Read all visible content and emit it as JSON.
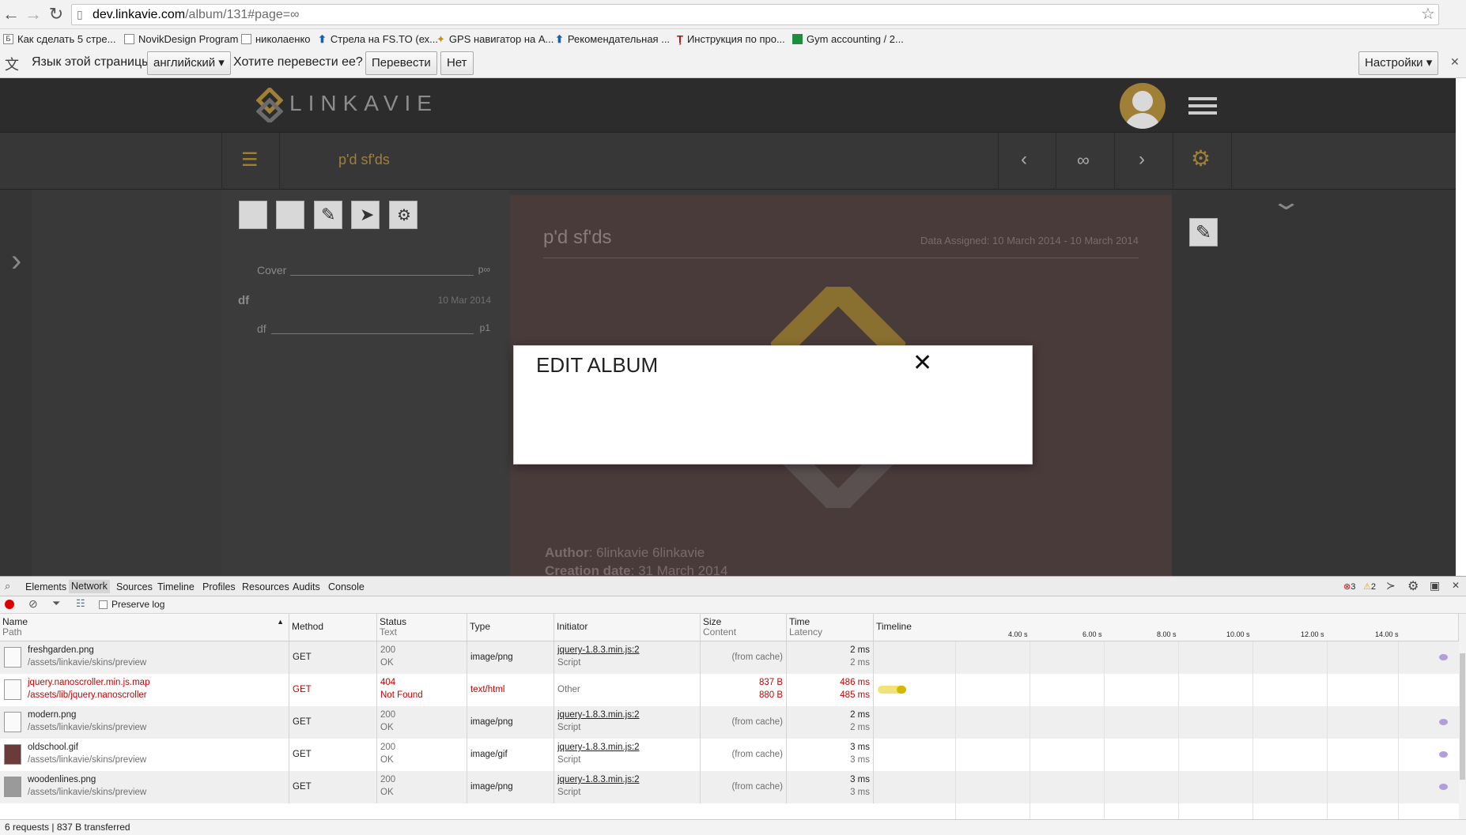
{
  "browser": {
    "url_host": "dev.linkavie.com",
    "url_path": "/album/131#page=∞",
    "bookmarks": [
      {
        "label": "Как сделать 5 стре..."
      },
      {
        "label": "NovikDesign Program"
      },
      {
        "label": "николаенко"
      },
      {
        "label": "Стрела на FS.TO (ех..."
      },
      {
        "label": "GPS навигатор на А..."
      },
      {
        "label": "Рекомендательная ..."
      },
      {
        "label": "Инструкция по про..."
      },
      {
        "label": "Gym accounting / 2..."
      }
    ],
    "translate": {
      "prompt": "Язык этой страницы",
      "language": "английский",
      "question": "Хотите перевести ее?",
      "translate_button": "Перевести",
      "no_button": "Нет",
      "settings_button": "Настройки"
    }
  },
  "app": {
    "brand": "LINKAVIE",
    "album_name": "p'd sf'ds",
    "infinity": "∞",
    "toc": [
      {
        "label": "Cover",
        "page": "p∞"
      },
      {
        "section": "df",
        "date": "10 Mar 2014"
      },
      {
        "label": "df",
        "page": "p1"
      }
    ],
    "page": {
      "title": "p'd sf'ds",
      "date_assigned": "Data Assigned: 10 March 2014 - 10 March 2014",
      "author_label": "Author",
      "author_value": ": 6linkavie 6linkavie",
      "creation_label": "Creation date",
      "creation_value": ": 31 March 2014"
    },
    "colors": {
      "accent": "#a08037",
      "header": "#2c2c2c",
      "page": "#4a3b3b"
    }
  },
  "modal": {
    "title": "EDIT ALBUM",
    "close_icon": "✕"
  },
  "devtools": {
    "tabs": [
      "Elements",
      "Network",
      "Sources",
      "Timeline",
      "Profiles",
      "Resources",
      "Audits",
      "Console"
    ],
    "errors": "3",
    "warnings": "2",
    "preserve_log": "Preserve log",
    "headers": {
      "name": "Name",
      "path": "Path",
      "method": "Method",
      "status": "Status",
      "text": "Text",
      "type": "Type",
      "initiator": "Initiator",
      "size": "Size",
      "content": "Content",
      "time": "Time",
      "latency": "Latency",
      "timeline": "Timeline"
    },
    "timeline_ticks": [
      "4.00 s",
      "6.00 s",
      "8.00 s",
      "10.00 s",
      "12.00 s",
      "14.00 s"
    ],
    "rows": [
      {
        "name": "freshgarden.png",
        "path": "/assets/linkavie/skins/preview",
        "method": "GET",
        "status": "200",
        "status_text": "OK",
        "type": "image/png",
        "initiator": "jquery-1.8.3.min.js:2",
        "initiator_sub": "Script",
        "size": "(from cache)",
        "size_sub": "",
        "time": "2 ms",
        "latency": "2 ms",
        "error": false
      },
      {
        "name": "jquery.nanoscroller.min.js.map",
        "path": "/assets/lib/jquery.nanoscroller",
        "method": "GET",
        "status": "404",
        "status_text": "Not Found",
        "type": "text/html",
        "initiator": "Other",
        "initiator_sub": "",
        "size": "837 B",
        "size_sub": "880 B",
        "time": "486 ms",
        "latency": "485 ms",
        "error": true
      },
      {
        "name": "modern.png",
        "path": "/assets/linkavie/skins/preview",
        "method": "GET",
        "status": "200",
        "status_text": "OK",
        "type": "image/png",
        "initiator": "jquery-1.8.3.min.js:2",
        "initiator_sub": "Script",
        "size": "(from cache)",
        "size_sub": "",
        "time": "2 ms",
        "latency": "2 ms",
        "error": false
      },
      {
        "name": "oldschool.gif",
        "path": "/assets/linkavie/skins/preview",
        "method": "GET",
        "status": "200",
        "status_text": "OK",
        "type": "image/gif",
        "initiator": "jquery-1.8.3.min.js:2",
        "initiator_sub": "Script",
        "size": "(from cache)",
        "size_sub": "",
        "time": "3 ms",
        "latency": "3 ms",
        "error": false
      },
      {
        "name": "woodenlines.png",
        "path": "/assets/linkavie/skins/preview",
        "method": "GET",
        "status": "200",
        "status_text": "OK",
        "type": "image/png",
        "initiator": "jquery-1.8.3.min.js:2",
        "initiator_sub": "Script",
        "size": "(from cache)",
        "size_sub": "",
        "time": "3 ms",
        "latency": "3 ms",
        "error": false
      }
    ],
    "summary": "6 requests  |  837 B transferred"
  }
}
